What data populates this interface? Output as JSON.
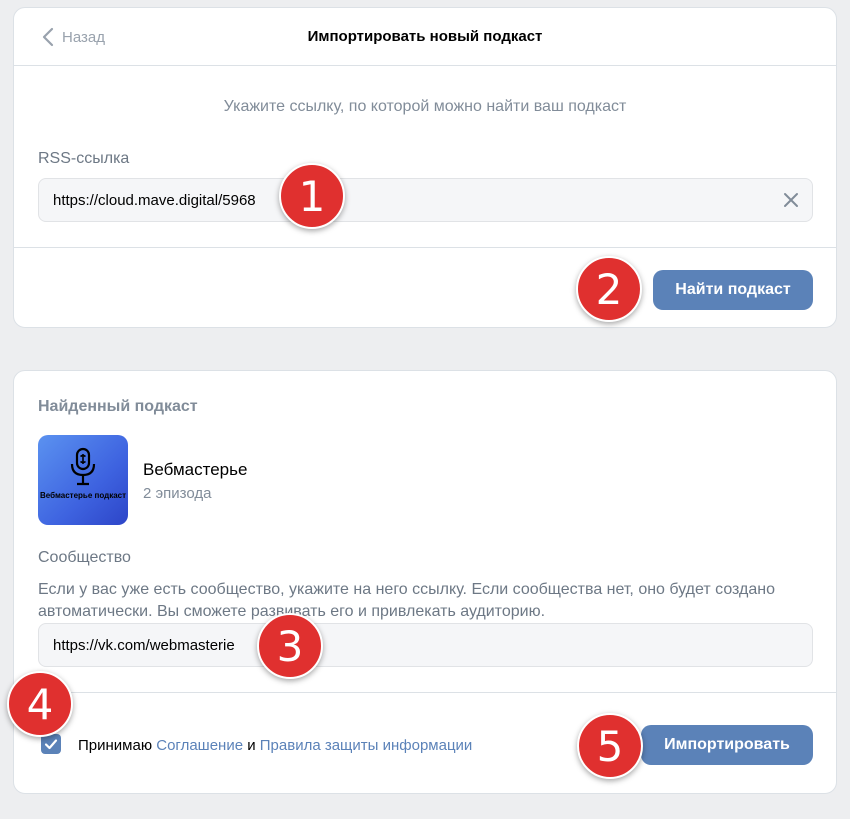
{
  "import_card": {
    "back_label": "Назад",
    "title": "Импортировать новый подкаст",
    "hint": "Укажите ссылку, по которой можно найти ваш подкаст",
    "rss_label": "RSS-ссылка",
    "rss_value": "https://cloud.mave.digital/5968",
    "find_button": "Найти подкаст"
  },
  "found_card": {
    "section_title": "Найденный подкаст",
    "cover_text": "Вебмастерье подкаст",
    "podcast_name": "Вебмастерье",
    "episodes": "2 эпизода",
    "community_label": "Сообщество",
    "community_description": "Если у вас уже есть сообщество, укажите на него ссылку. Если сообщества нет, оно будет создано автоматически. Вы сможете развивать его и привлекать аудиторию.",
    "community_value": "https://vk.com/webmasterie",
    "agree_prefix": "Принимаю ",
    "agreement_link": "Соглашение",
    "agree_and": " и ",
    "privacy_link": "Правила защиты информации",
    "agree_checked": true,
    "import_button": "Импортировать"
  },
  "badges": [
    "1",
    "2",
    "3",
    "4",
    "5"
  ],
  "colors": {
    "background": "#edeef0",
    "accent": "#5b82b8",
    "badge": "#e0302f",
    "muted_text": "#818c99"
  },
  "icons": {
    "back": "chevron-left-icon",
    "clear": "close-icon",
    "checkbox": "checkmark-icon",
    "cover": "microphone-icon"
  }
}
